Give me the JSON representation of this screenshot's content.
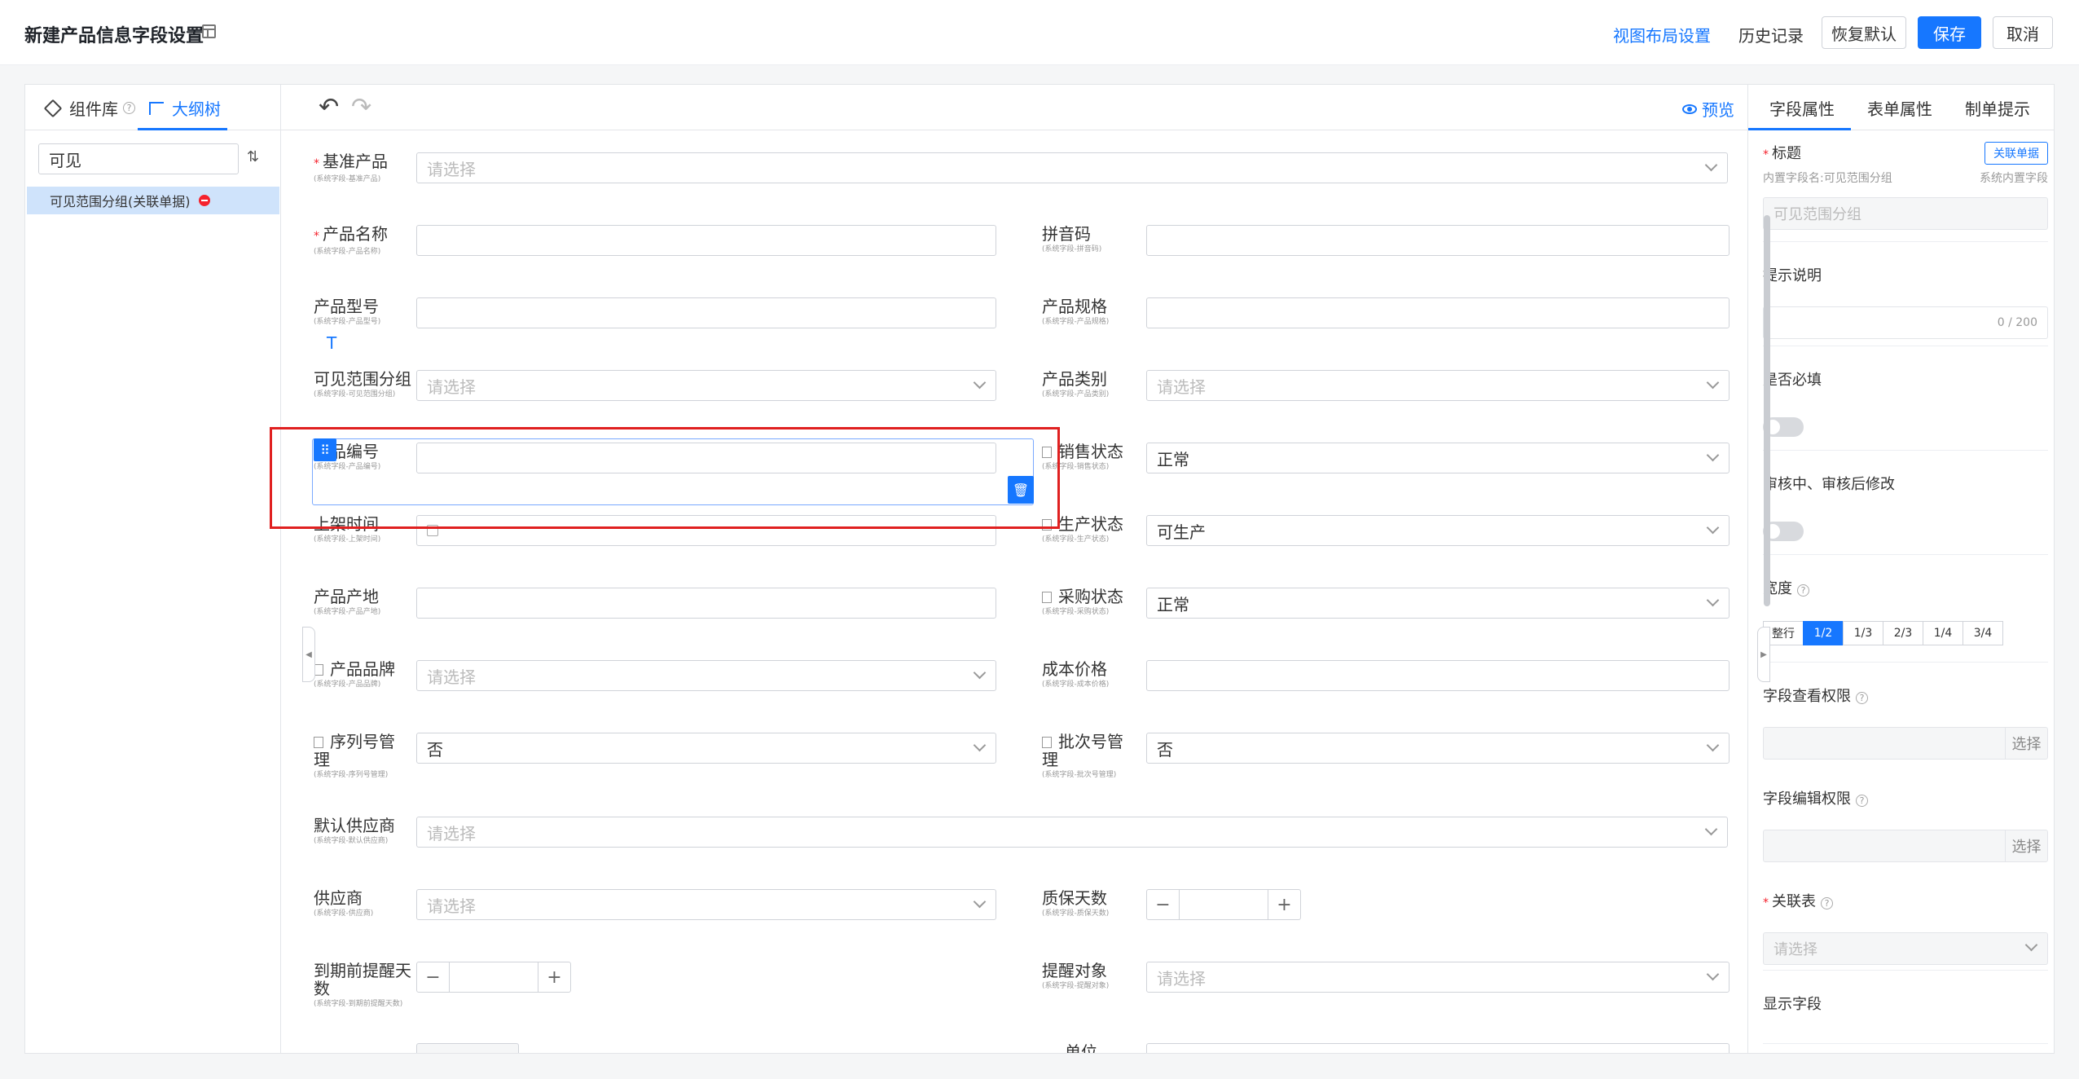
{
  "header": {
    "title": "新建产品信息字段设置",
    "view_layout": "视图布局设置",
    "history": "历史记录",
    "restore": "恢复默认",
    "save": "保存",
    "cancel": "取消"
  },
  "left_panel": {
    "tab_components": "组件库",
    "tab_outline": "大纲树",
    "search_value": "可见",
    "tree_item": "可见范围分组(关联单据)"
  },
  "toolbar": {
    "preview": "预览"
  },
  "placeholder": "请选择",
  "fields": {
    "base_product": {
      "label": "基准产品",
      "sub": "(系统字段-基准产品)"
    },
    "product_name": {
      "label": "产品名称",
      "sub": "(系统字段-产品名称)"
    },
    "pinyin": {
      "label": "拼音码",
      "sub": "(系统字段-拼音码)"
    },
    "model": {
      "label": "产品型号",
      "sub": "(系统字段-产品型号)"
    },
    "spec": {
      "label": "产品规格",
      "sub": "(系统字段-产品规格)"
    },
    "visible_group": {
      "label": "可见范围分组",
      "sub": "(系统字段-可见范围分组)"
    },
    "category": {
      "label": "产品类别",
      "sub": "(系统字段-产品类别)"
    },
    "code": {
      "label": "产品编号",
      "sub": "(系统字段-产品编号)"
    },
    "sales_status": {
      "label": "销售状态",
      "sub": "(系统字段-销售状态)",
      "value": "正常"
    },
    "list_time": {
      "label": "上架时间",
      "sub": "(系统字段-上架时间)"
    },
    "prod_status": {
      "label": "生产状态",
      "sub": "(系统字段-生产状态)",
      "value": "可生产"
    },
    "origin": {
      "label": "产品产地",
      "sub": "(系统字段-产品产地)"
    },
    "purchase_status": {
      "label": "采购状态",
      "sub": "(系统字段-采购状态)",
      "value": "正常"
    },
    "brand": {
      "label": "产品品牌",
      "sub": "(系统字段-产品品牌)"
    },
    "cost": {
      "label": "成本价格",
      "sub": "(系统字段-成本价格)"
    },
    "serial": {
      "label": "序列号管理",
      "sub": "(系统字段-序列号管理)",
      "value": "否"
    },
    "batch": {
      "label": "批次号管理",
      "sub": "(系统字段-批次号管理)",
      "value": "否"
    },
    "default_supplier": {
      "label": "默认供应商",
      "sub": "(系统字段-默认供应商)"
    },
    "supplier": {
      "label": "供应商",
      "sub": "(系统字段-供应商)"
    },
    "warranty": {
      "label": "质保天数",
      "sub": "(系统字段-质保天数)"
    },
    "expiry_remind": {
      "label": "到期前提醒天数",
      "sub": "(系统字段-到期前提醒天数)"
    },
    "remind_target": {
      "label": "提醒对象",
      "sub": "(系统字段-提醒对象)"
    },
    "unit": {
      "label": "单位"
    }
  },
  "right_panel": {
    "tab_field": "字段属性",
    "tab_form": "表单属性",
    "tab_tips": "制单提示",
    "title_label": "标题",
    "link_doc": "关联单据",
    "builtin_name": "内置字段名:可见范围分组",
    "builtin_tag": "系统内置字段",
    "title_value": "可见范围分组",
    "hint_label": "提示说明",
    "hint_count": "0 / 200",
    "required_label": "是否必填",
    "audit_label": "审核中、审核后修改",
    "width_label": "宽度",
    "width_options": [
      "整行",
      "1/2",
      "1/3",
      "2/3",
      "1/4",
      "3/4"
    ],
    "view_perm": "字段查看权限",
    "edit_perm": "字段编辑权限",
    "pick": "选择",
    "related_table": "关联表",
    "related_placeholder": "请选择",
    "display_field": "显示字段"
  }
}
